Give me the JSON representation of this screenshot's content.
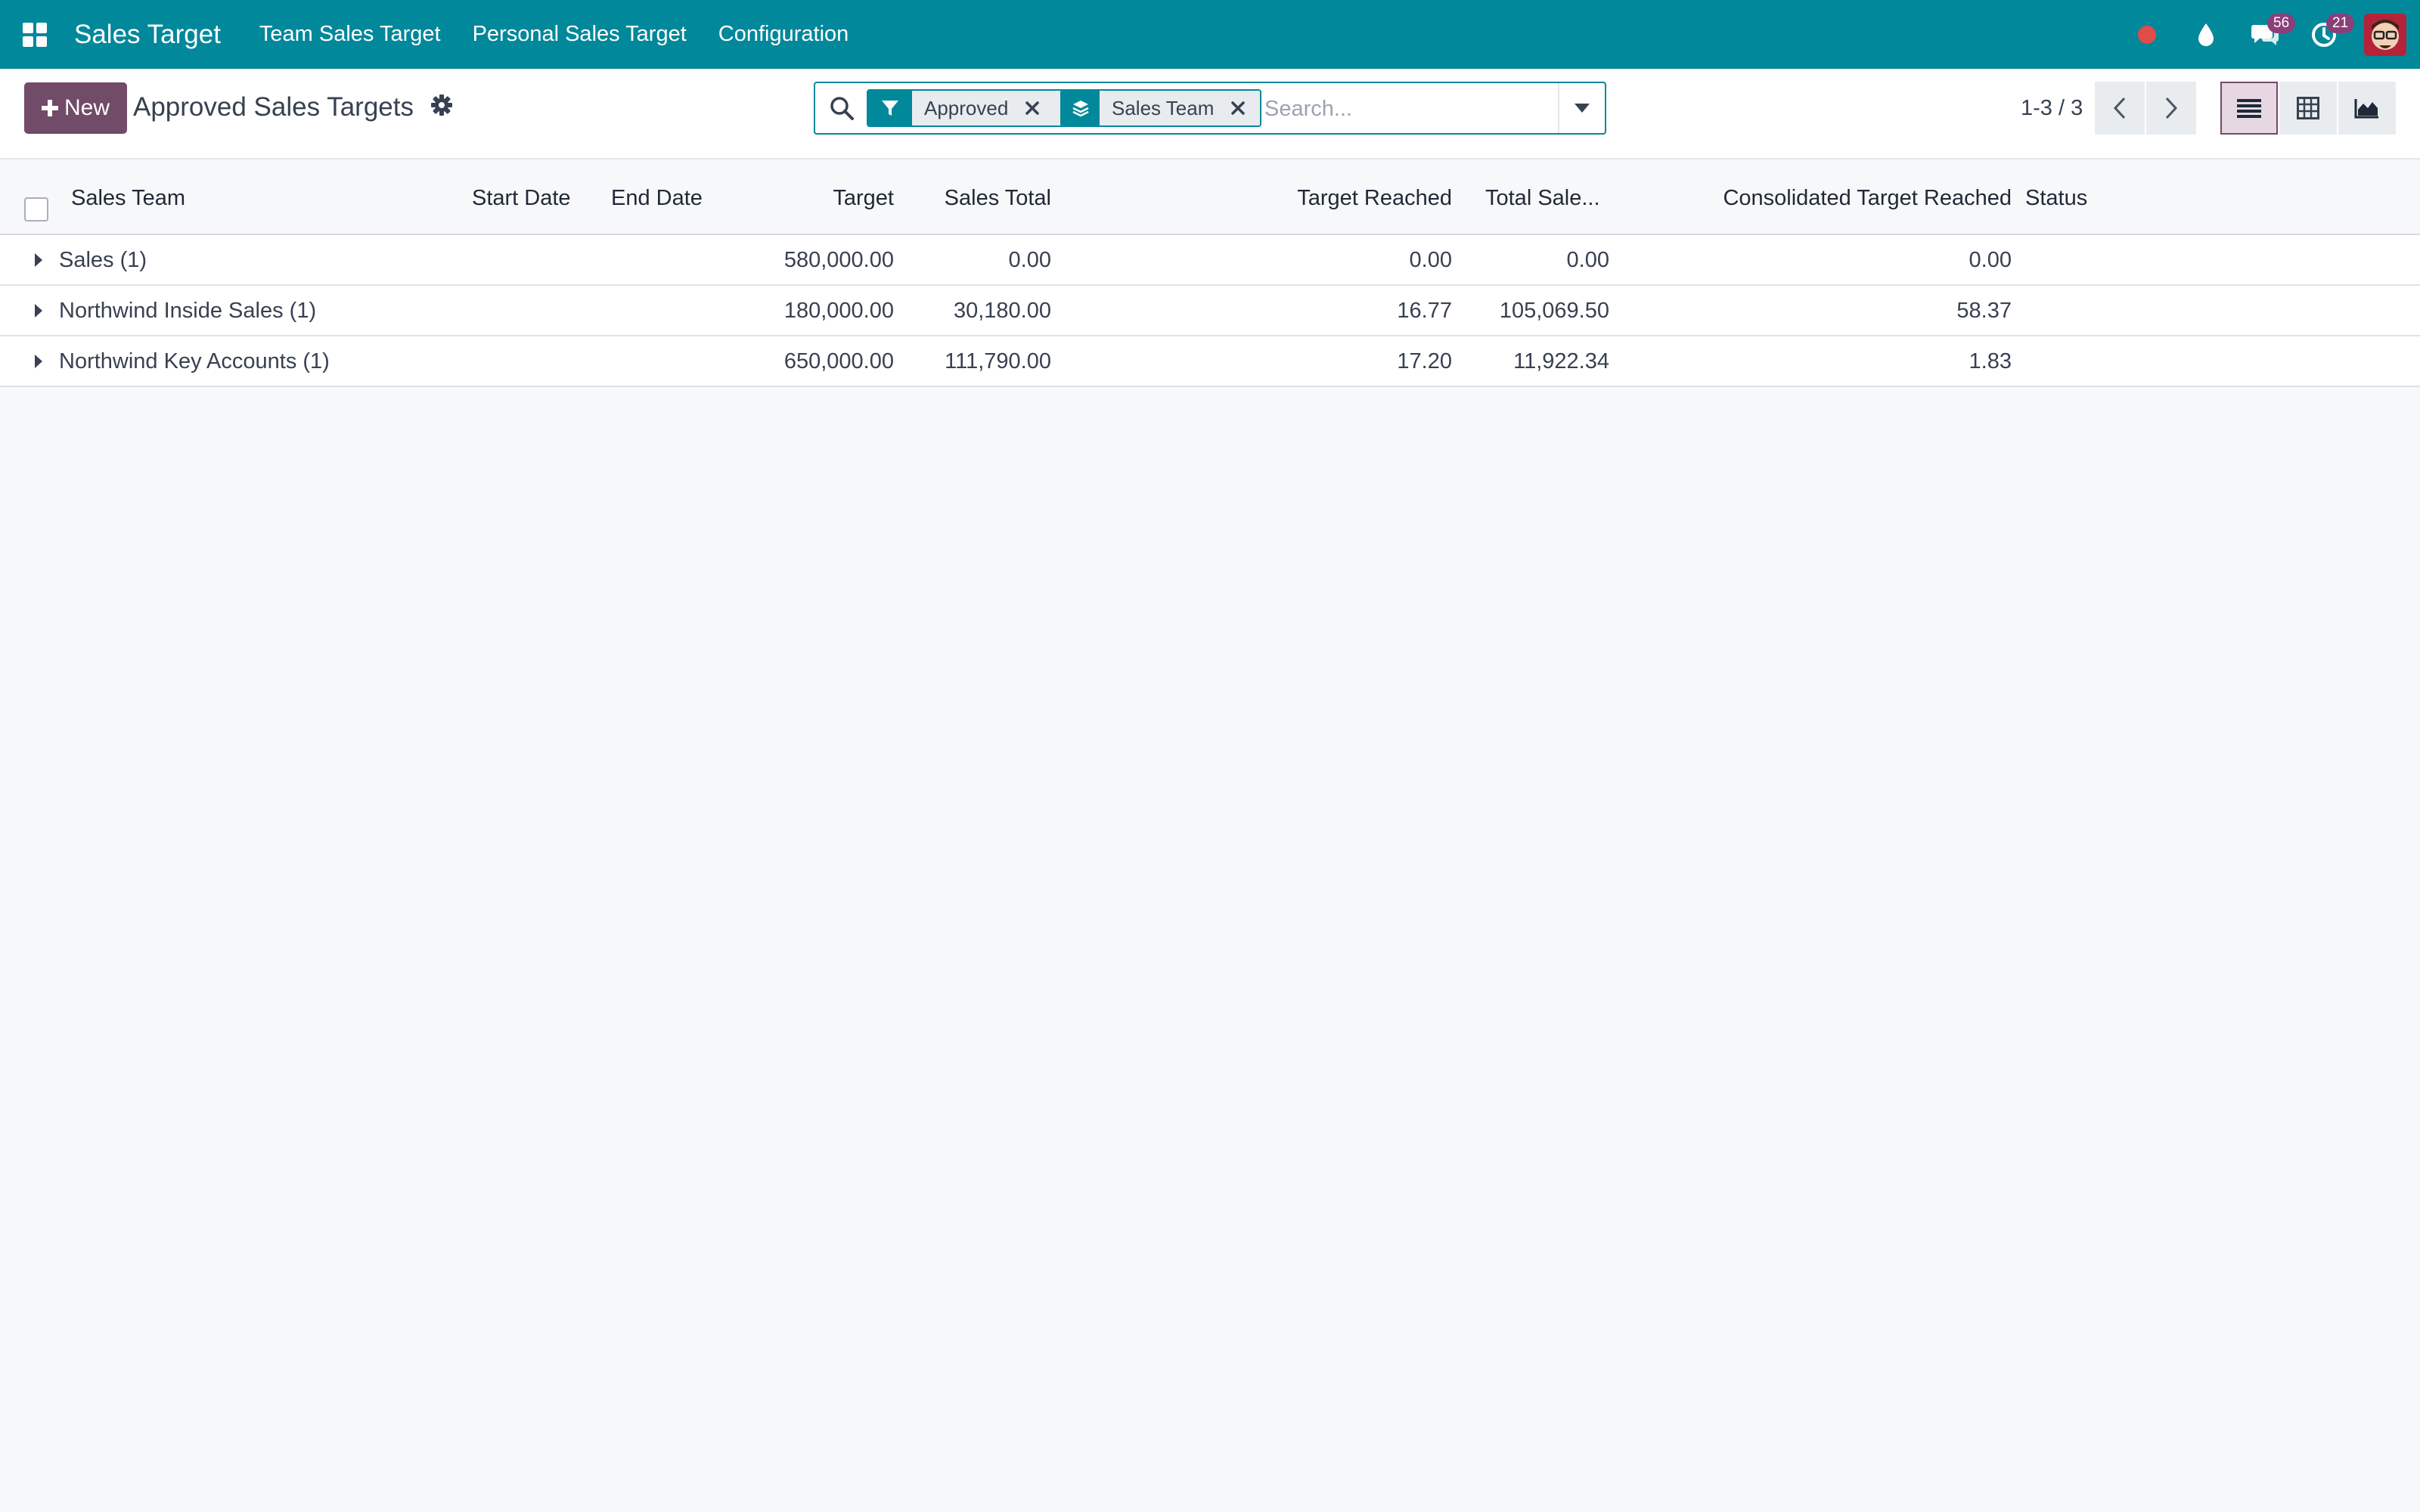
{
  "navbar": {
    "brand": "Sales Target",
    "menu": [
      "Team Sales Target",
      "Personal Sales Target",
      "Configuration"
    ],
    "chat_count": "56",
    "activity_count": "21"
  },
  "control": {
    "new_label": "New",
    "title": "Approved Sales Targets",
    "facets": [
      {
        "icon": "filter-icon",
        "label": "Approved"
      },
      {
        "icon": "group-by-icon",
        "label": "Sales Team"
      }
    ],
    "search_placeholder": "Search...",
    "pager": "1-3 / 3"
  },
  "table": {
    "columns": [
      "Sales Team",
      "Start Date",
      "End Date",
      "Target",
      "Sales Total",
      "Target Reached",
      "Total Sale...",
      "Consolidated Target Reached",
      "Status"
    ],
    "groups": [
      {
        "name": "Sales (1)",
        "target": "580,000.00",
        "sales_total": "0.00",
        "target_reached": "0.00",
        "total_sales": "0.00",
        "consolidated": "0.00"
      },
      {
        "name": "Northwind Inside Sales (1)",
        "target": "180,000.00",
        "sales_total": "30,180.00",
        "target_reached": "16.77",
        "total_sales": "105,069.50",
        "consolidated": "58.37"
      },
      {
        "name": "Northwind Key Accounts (1)",
        "target": "650,000.00",
        "sales_total": "111,790.00",
        "target_reached": "17.20",
        "total_sales": "11,922.34",
        "consolidated": "1.83"
      }
    ]
  },
  "colors": {
    "navbar": "#01889a",
    "primary_button": "#714b67",
    "badge": "#8a3f78",
    "recording_dot": "#e04b4b"
  }
}
